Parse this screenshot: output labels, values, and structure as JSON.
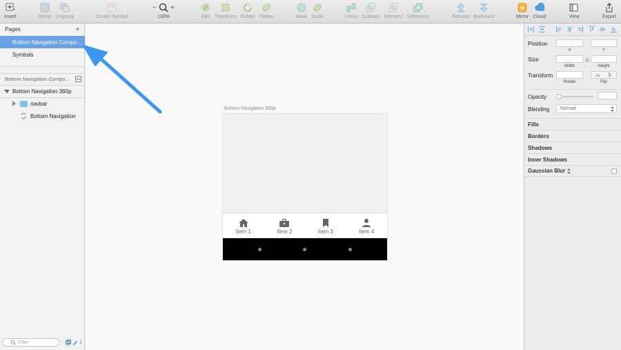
{
  "toolbar": {
    "insert": "Insert",
    "group": "Group",
    "ungroup": "Ungroup",
    "create_symbol": "Create Symbol",
    "zoom_minus": "−",
    "zoom_plus": "+",
    "zoom": "100%",
    "edit": "Edit",
    "transform": "Transform",
    "rotate": "Rotate",
    "flatten": "Flatten",
    "mask": "Mask",
    "scale": "Scale",
    "union": "Union",
    "subtract": "Subtract",
    "intersect": "Intersect",
    "difference": "Difference",
    "forward": "Forward",
    "backward": "Backward",
    "mirror": "Mirror",
    "cloud": "Cloud",
    "view": "View",
    "export": "Export"
  },
  "pages": {
    "header": "Pages",
    "items": [
      {
        "label": "Bottom Navigation Compo..."
      },
      {
        "label": "Symbols"
      }
    ]
  },
  "layers": {
    "page_name": "Bottom Navigation Compo...",
    "artboard": "Bottom Navigation 360p",
    "children": [
      {
        "label": "navbar"
      },
      {
        "label": "Bottom Navigation"
      }
    ],
    "filter_placeholder": "Filter",
    "count": "1"
  },
  "canvas": {
    "artboard_title": "Bottom Navigation 360p",
    "nav_items": [
      {
        "label": "Item 1",
        "icon": "home-icon"
      },
      {
        "label": "Item 2",
        "icon": "briefcase-icon"
      },
      {
        "label": "Item 3",
        "icon": "bookmark-icon"
      },
      {
        "label": "Item 4",
        "icon": "person-icon"
      }
    ]
  },
  "inspector": {
    "position": "Position",
    "x": "X",
    "y": "Y",
    "size": "Size",
    "width": "Width",
    "height": "Height",
    "transform": "Transform",
    "rotate": "Rotate",
    "flip": "Flip",
    "opacity": "Opacity",
    "blending": "Blending",
    "blending_value": "Normal",
    "fills": "Fills",
    "borders": "Borders",
    "shadows": "Shadows",
    "inner_shadows": "Inner Shadows",
    "gaussian_blur": "Gaussian Blur"
  },
  "colors": {
    "selection": "#6aa1e8",
    "arrow": "#3b97ef"
  }
}
